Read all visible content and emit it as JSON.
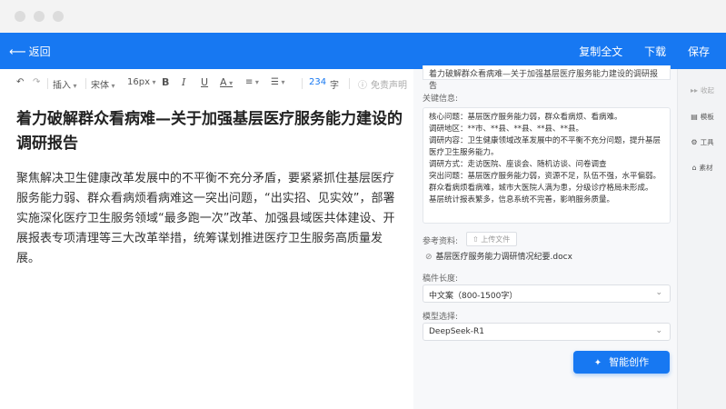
{
  "topbar": {
    "back_label": "返回",
    "copy_label": "复制全文",
    "download_label": "下载",
    "save_label": "保存"
  },
  "toolbar": {
    "insert": "插入",
    "font": "宋体",
    "size": "16px",
    "bold": "B",
    "italic": "I",
    "underline": "U",
    "font_color": "A",
    "word_count": "234",
    "word_unit": "字",
    "disclaimer": "免责声明"
  },
  "document": {
    "title": "着力破解群众看病难—关于加强基层医疗服务能力建设的调研报告",
    "body": "聚焦解决卫生健康改革发展中的不平衡不充分矛盾，要紧紧抓住基层医疗服务能力弱、群众看病烦看病难这一突出问题，“出实招、见实效”，部署实施深化医疗卫生服务领域“最多跑一次”改革、加强县域医共体建设、开展报表专项清理等三大改革举措，统筹谋划推进医疗卫生服务高质量发展。"
  },
  "panel": {
    "title_value": "着力破解群众看病难—关于加强基层医疗服务能力建设的调研报告",
    "key_info_label": "关键信息:",
    "key_info_lines": [
      "核心问题：基层医疗服务能力弱，群众看病烦、看病难。",
      "调研地区：**市、**县、**县、**县、**县。",
      "调研内容：卫生健康领域改革发展中的不平衡不充分问题，提升基层",
      "医疗卫生服务能力。",
      "调研方式：走访医院、座谈会、随机访谈、问卷调查",
      "突出问题：基层医疗服务能力弱，资源不足，队伍不强，水平偏弱。",
      "群众看病烦看病难，城市大医院人满为患，分级诊疗格局未形成。",
      "基层统计报表繁多，信息系统不完善，影响服务质量。"
    ],
    "reference_label": "参考资料:",
    "upload_label": "上传文件",
    "file_name": "基层医疗服务能力调研情况纪要.docx",
    "length_label": "稿件长度:",
    "length_value": "中文案（800-1500字）",
    "model_label": "模型选择:",
    "model_value": "DeepSeek-R1",
    "create_label": "智能创作"
  },
  "sidebar": {
    "collapse": "收起",
    "template": "模板",
    "tools": "工具",
    "material": "素材"
  },
  "colors": {
    "primary": "#1778f2",
    "panel_bg": "#f7f8fa"
  }
}
